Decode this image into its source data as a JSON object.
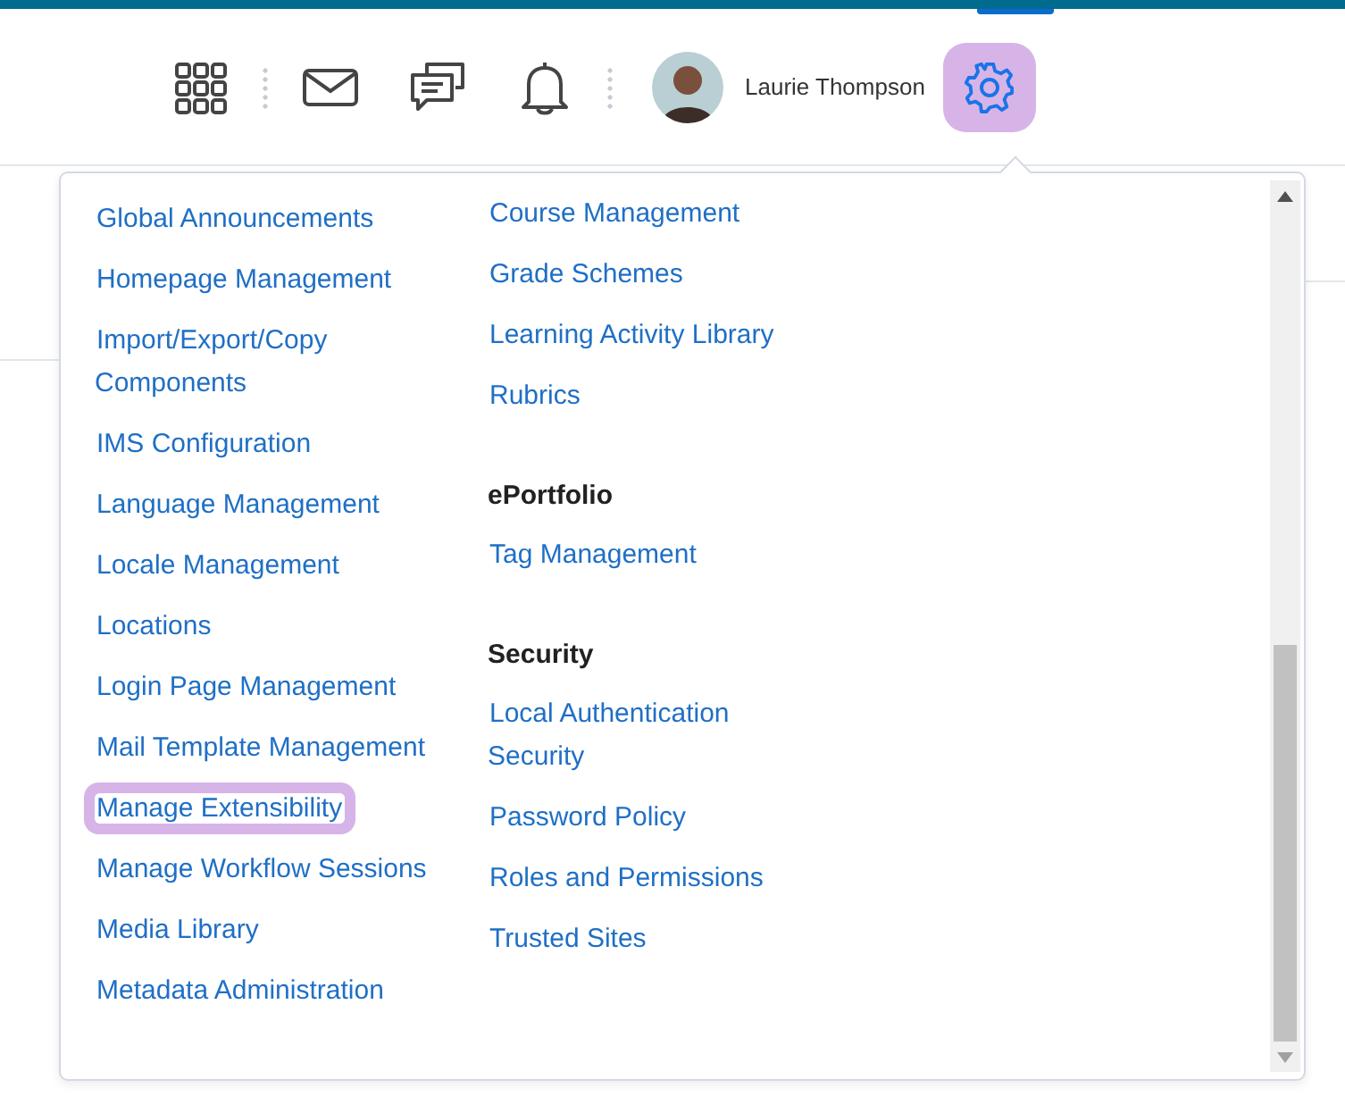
{
  "header": {
    "user_name": "Laurie Thompson",
    "settings_highlighted": true
  },
  "menu": {
    "columns": [
      {
        "groups": [
          {
            "items": [
              {
                "label": "Global Announcements",
                "highlighted": false
              },
              {
                "label": "Homepage Management",
                "highlighted": false
              },
              {
                "label": "Import/Export/Copy Components",
                "highlighted": false
              },
              {
                "label": "IMS Configuration",
                "highlighted": false
              },
              {
                "label": "Language Management",
                "highlighted": false
              },
              {
                "label": "Locale Management",
                "highlighted": false
              },
              {
                "label": "Locations",
                "highlighted": false
              },
              {
                "label": "Login Page Management",
                "highlighted": false
              },
              {
                "label": "Mail Template Management",
                "highlighted": false
              },
              {
                "label": "Manage Extensibility",
                "highlighted": true
              },
              {
                "label": "Manage Workflow Sessions",
                "highlighted": false
              },
              {
                "label": "Media Library",
                "highlighted": false
              },
              {
                "label": "Metadata Administration",
                "highlighted": false
              }
            ]
          }
        ]
      },
      {
        "groups": [
          {
            "items": [
              {
                "label": "Course Management",
                "highlighted": false
              },
              {
                "label": "Grade Schemes",
                "highlighted": false
              },
              {
                "label": "Learning Activity Library",
                "highlighted": false
              },
              {
                "label": "Rubrics",
                "highlighted": false
              }
            ]
          },
          {
            "heading": "ePortfolio",
            "items": [
              {
                "label": "Tag Management",
                "highlighted": false
              }
            ]
          },
          {
            "heading": "Security",
            "items": [
              {
                "label": "Local Authentication Security",
                "highlighted": false
              },
              {
                "label": "Password Policy",
                "highlighted": false
              },
              {
                "label": "Roles and Permissions",
                "highlighted": false
              },
              {
                "label": "Trusted Sites",
                "highlighted": false
              }
            ]
          }
        ]
      }
    ]
  }
}
